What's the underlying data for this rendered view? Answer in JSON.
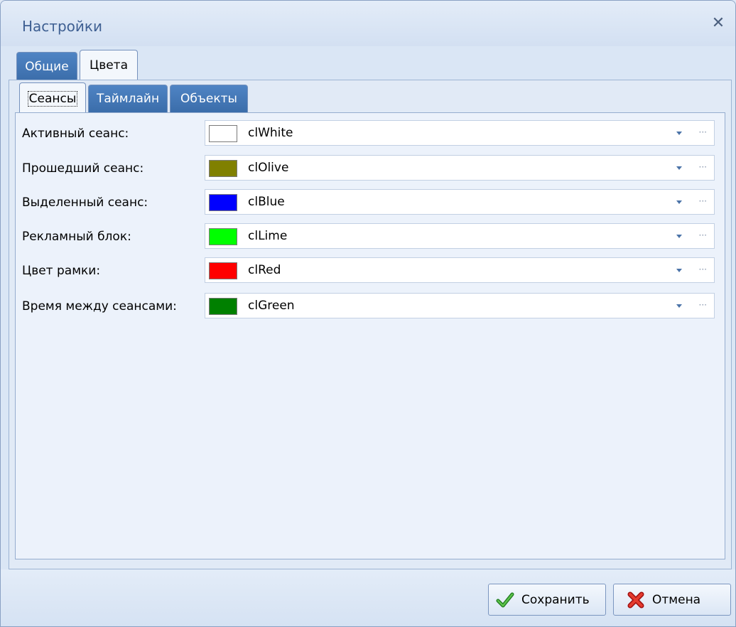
{
  "window": {
    "title": "Настройки"
  },
  "tabs": [
    {
      "label": "Общие"
    },
    {
      "label": "Цвета"
    }
  ],
  "subtabs": [
    {
      "label": "Сеансы"
    },
    {
      "label": "Таймлайн"
    },
    {
      "label": "Объекты"
    }
  ],
  "colors": [
    {
      "label": "Активный сеанс:",
      "value": "clWhite",
      "swatch": "#ffffff"
    },
    {
      "label": "Прошедший сеанс:",
      "value": "clOlive",
      "swatch": "#808000"
    },
    {
      "label": "Выделенный сеанс:",
      "value": "clBlue",
      "swatch": "#0000ff"
    },
    {
      "label": "Рекламный блок:",
      "value": "clLime",
      "swatch": "#00ff00"
    },
    {
      "label": "Цвет рамки:",
      "value": "clRed",
      "swatch": "#ff0000"
    },
    {
      "label": "Время между сеансами:",
      "value": "clGreen",
      "swatch": "#008000"
    }
  ],
  "buttons": {
    "save": {
      "label": "Сохранить",
      "icon": "checkmark-icon"
    },
    "cancel": {
      "label": "Отмена",
      "icon": "red-x-icon"
    }
  },
  "icons": {
    "close": "close-icon",
    "dropdown": "chevron-down-icon",
    "ellipsis": "ellipsis-icon"
  },
  "theme": {
    "accent": "#3a6ca9",
    "title_color": "#3e5f92"
  }
}
